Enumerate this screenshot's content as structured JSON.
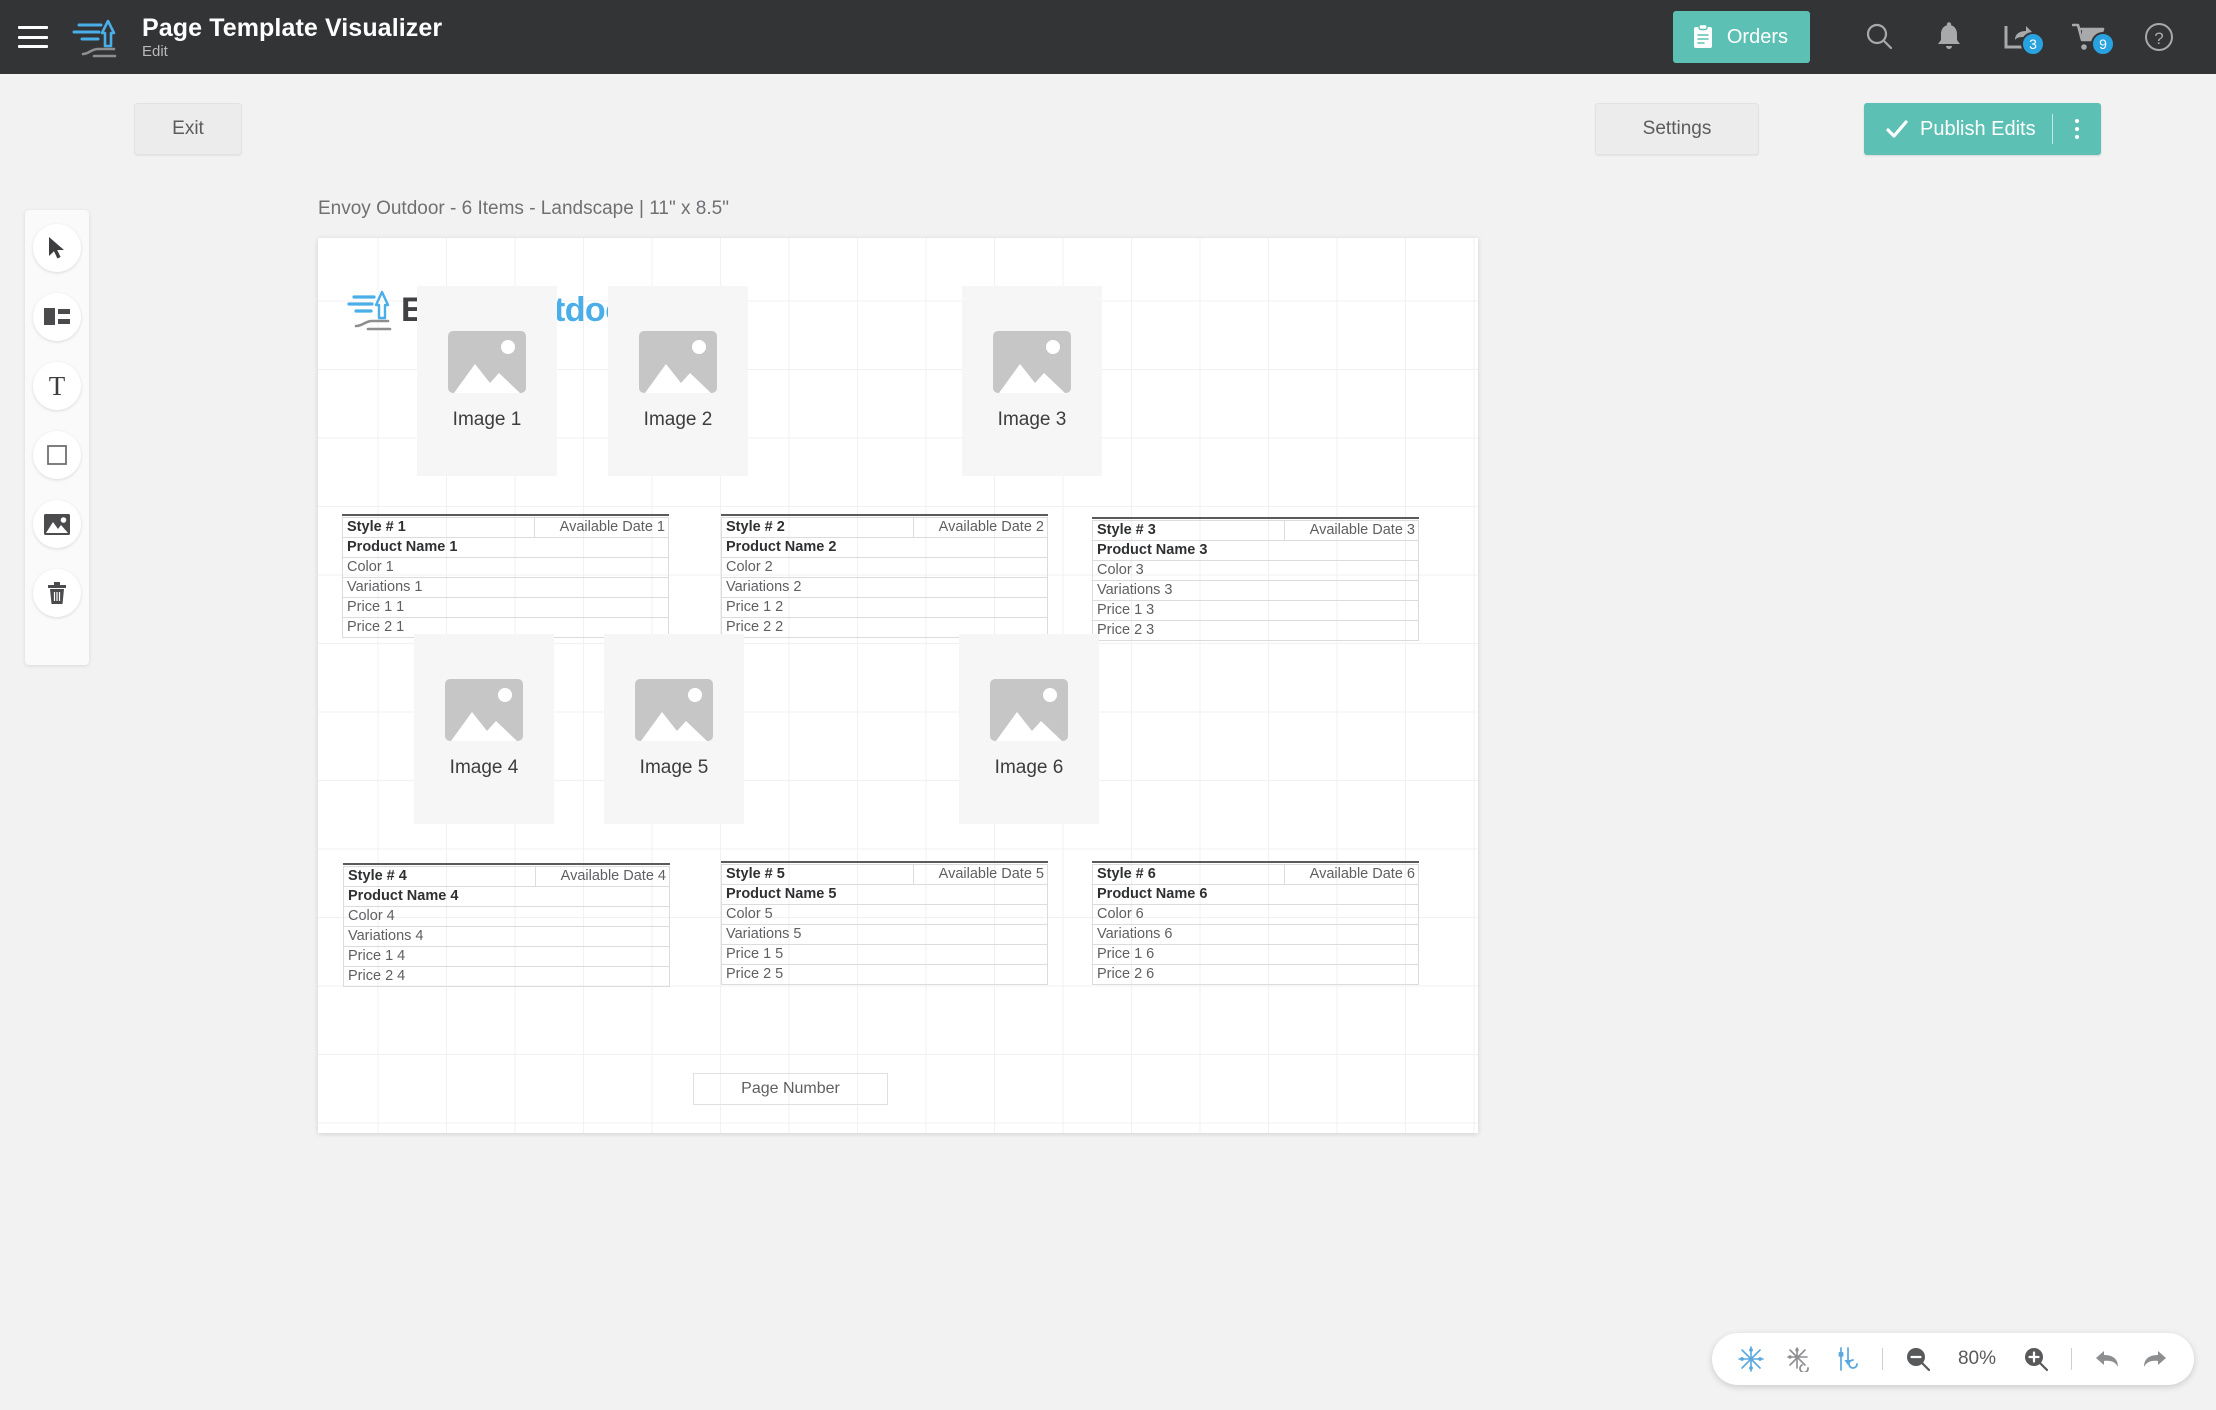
{
  "header": {
    "menu_icon": "hamburger-menu-icon",
    "logo_icon": "envoy-outdoor-logo-icon",
    "title": "Page Template Visualizer",
    "subtitle": "Edit",
    "orders_label": "Orders",
    "orders_icon": "clipboard-icon",
    "search_icon": "search-icon",
    "notifications_icon": "bell-icon",
    "share_icon": "share-icon",
    "share_badge": "3",
    "cart_icon": "cart-icon",
    "cart_badge": "9",
    "help_icon": "question-mark-icon",
    "accent_color": "#5cc0b4",
    "badge_color": "#29a3e0",
    "bar_color": "#333436"
  },
  "actions": {
    "exit_label": "Exit",
    "settings_label": "Settings",
    "publish_label": "Publish Edits",
    "publish_icon": "checkmark-icon",
    "publish_menu_icon": "kebab-menu-icon"
  },
  "toolbar": {
    "tools": [
      {
        "name": "select-tool",
        "icon": "cursor-arrow-icon"
      },
      {
        "name": "layout-block-tool",
        "icon": "content-block-icon"
      },
      {
        "name": "text-tool",
        "icon": "text-t-icon",
        "glyph": "T"
      },
      {
        "name": "shape-tool",
        "icon": "square-outline-icon"
      },
      {
        "name": "image-tool",
        "icon": "image-icon"
      },
      {
        "name": "delete-tool",
        "icon": "trash-icon"
      }
    ]
  },
  "canvas": {
    "caption": "Envoy Outdoor - 6 Items - Landscape | 11\" x 8.5\"",
    "logo_primary": "Envoy",
    "logo_secondary": "Outdoor",
    "logo_primary_color": "#414042",
    "logo_secondary_color": "#4aaee8",
    "page_number_label": "Page Number",
    "products": [
      {
        "image_caption": "Image 1",
        "style": "Style # 1",
        "available_date": "Available Date 1",
        "product_name": "Product Name 1",
        "color": "Color 1",
        "variations": "Variations 1",
        "price1": "Price 1 1",
        "price2": "Price 2 1"
      },
      {
        "image_caption": "Image 2",
        "style": "Style # 2",
        "available_date": "Available Date 2",
        "product_name": "Product Name 2",
        "color": "Color 2",
        "variations": "Variations 2",
        "price1": "Price 1 2",
        "price2": "Price 2 2"
      },
      {
        "image_caption": "Image 3",
        "style": "Style # 3",
        "available_date": "Available Date 3",
        "product_name": "Product Name 3",
        "color": "Color 3",
        "variations": "Variations 3",
        "price1": "Price 1 3",
        "price2": "Price 2 3"
      },
      {
        "image_caption": "Image 4",
        "style": "Style # 4",
        "available_date": "Available Date 4",
        "product_name": "Product Name 4",
        "color": "Color 4",
        "variations": "Variations 4",
        "price1": "Price 1 4",
        "price2": "Price 2 4"
      },
      {
        "image_caption": "Image 5",
        "style": "Style # 5",
        "available_date": "Available Date 5",
        "product_name": "Product Name 5",
        "color": "Color 5",
        "variations": "Variations 5",
        "price1": "Price 1 5",
        "price2": "Price 2 5"
      },
      {
        "image_caption": "Image 6",
        "style": "Style # 6",
        "available_date": "Available Date 6",
        "product_name": "Product Name 6",
        "color": "Color 6",
        "variations": "Variations 6",
        "price1": "Price 1 6",
        "price2": "Price 2 6"
      }
    ]
  },
  "zoombar": {
    "snap_on_icon": "snap-to-grid-on-icon",
    "snap_off_icon": "snap-to-grid-off-icon",
    "align_guides_icon": "alignment-guides-icon",
    "zoom_out_icon": "zoom-out-icon",
    "zoom_level": "80%",
    "zoom_in_icon": "zoom-in-icon",
    "undo_icon": "undo-arrow-icon",
    "redo_icon": "redo-arrow-icon"
  }
}
